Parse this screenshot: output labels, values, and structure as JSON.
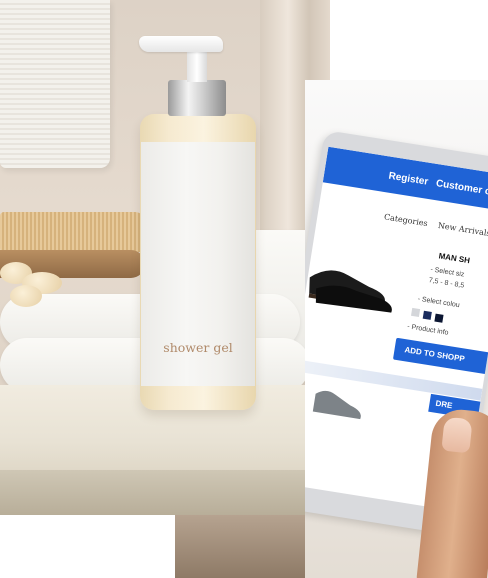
{
  "left_photo": {
    "bottle_label": "shower gel"
  },
  "tablet_screen": {
    "register": "Register",
    "customer": "Customer ca",
    "nav": [
      "Categories",
      "New Arrivals"
    ],
    "product_title": "MAN SH",
    "size_option": "- Select siz",
    "size_values": "7,5 - 8 - 8,5",
    "colour_option": "- Select colou",
    "product_info": "- Product info",
    "add_button": "ADD TO SHOPP",
    "dre_button": "DRE",
    "colors": {
      "topbar": "#1f63d6"
    }
  }
}
